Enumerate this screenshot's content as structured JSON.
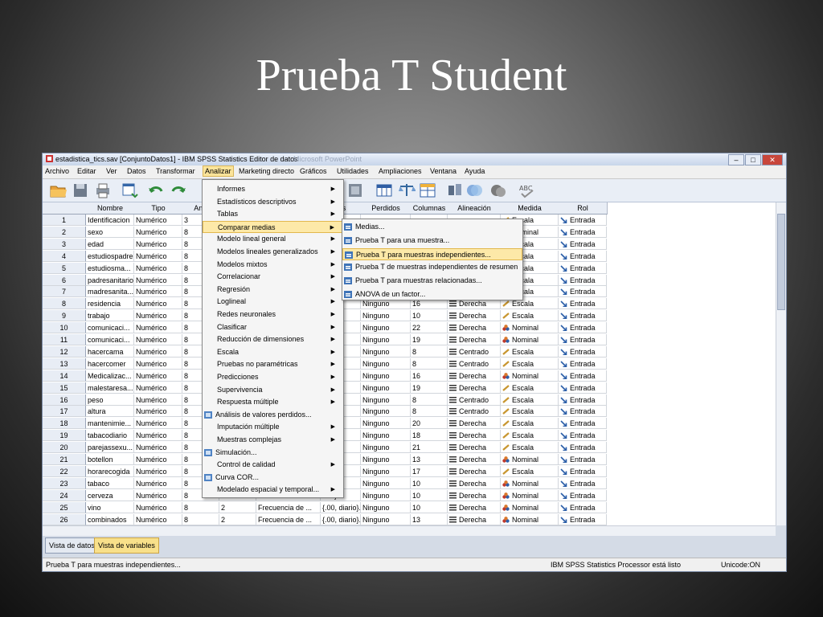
{
  "slide_title": "Prueba T Student",
  "window": {
    "title": "estadistica_tics.sav [ConjuntoDatos1] - IBM SPSS Statistics Editor de datos",
    "bg_title": "Microsoft PowerPoint",
    "buttons": [
      "–",
      "□",
      "✕"
    ]
  },
  "menubar": [
    "Archivo",
    "Editar",
    "Ver",
    "Datos",
    "Transformar",
    "Analizar",
    "Marketing directo",
    "Gráficos",
    "Utilidades",
    "Ampliaciones",
    "Ventana",
    "Ayuda"
  ],
  "menubar_active": "Analizar",
  "columns": [
    "Nombre",
    "Tipo",
    "Ancl",
    "res",
    "Perdidos",
    "Columnas",
    "Alineación",
    "Medida",
    "Rol"
  ],
  "rows": [
    {
      "n": "1",
      "nombre": "Identificacion",
      "tipo": "Numérico",
      "anc": "3",
      "dec": "",
      "etiq": "",
      "val": "",
      "perd": "",
      "col": "",
      "alin": "",
      "medida": "Escala",
      "rol": "Entrada"
    },
    {
      "n": "2",
      "nombre": "sexo",
      "tipo": "Numérico",
      "anc": "8",
      "dec": "",
      "etiq": "",
      "val": "",
      "perd": "",
      "col": "",
      "alin": "",
      "medida": "Nominal",
      "rol": "Entrada"
    },
    {
      "n": "3",
      "nombre": "edad",
      "tipo": "Numérico",
      "anc": "8",
      "dec": "",
      "etiq": "",
      "val": "",
      "perd": "",
      "col": "",
      "alin": "",
      "medida": "Escala",
      "rol": "Entrada"
    },
    {
      "n": "4",
      "nombre": "estudiospadre",
      "tipo": "Numérico",
      "anc": "8",
      "dec": "",
      "etiq": "",
      "val": "",
      "perd": "",
      "col": "",
      "alin": "",
      "medida": "Escala",
      "rol": "Entrada"
    },
    {
      "n": "5",
      "nombre": "estudiosma...",
      "tipo": "Numérico",
      "anc": "8",
      "dec": "",
      "etiq": "",
      "val": "",
      "perd": "",
      "col": "",
      "alin": "",
      "medida": "Escala",
      "rol": "Entrada"
    },
    {
      "n": "6",
      "nombre": "padresanitario",
      "tipo": "Numérico",
      "anc": "8",
      "dec": "",
      "etiq": "",
      "val": "",
      "perd": "",
      "col": "",
      "alin": "",
      "medida": "Escala",
      "rol": "Entrada"
    },
    {
      "n": "7",
      "nombre": "madresanita...",
      "tipo": "Numérico",
      "anc": "8",
      "dec": "",
      "etiq": "",
      "val": "",
      "perd": "",
      "col": "",
      "alin": "",
      "medida": "Escala",
      "rol": "Entrada"
    },
    {
      "n": "8",
      "nombre": "residencia",
      "tipo": "Numérico",
      "anc": "8",
      "dec": "",
      "etiq": "",
      "val": "iliar ...",
      "perd": "Ninguno",
      "col": "16",
      "alin": "Derecha",
      "medida": "Escala",
      "rol": "Entrada"
    },
    {
      "n": "9",
      "nombre": "trabajo",
      "tipo": "Numérico",
      "anc": "8",
      "dec": "",
      "etiq": "",
      "val": "",
      "perd": "Ninguno",
      "col": "10",
      "alin": "Derecha",
      "medida": "Escala",
      "rol": "Entrada"
    },
    {
      "n": "10",
      "nombre": "comunicaci...",
      "tipo": "Numérico",
      "anc": "8",
      "dec": "",
      "etiq": "",
      "val": "",
      "perd": "Ninguno",
      "col": "22",
      "alin": "Derecha",
      "medida": "Nominal",
      "rol": "Entrada"
    },
    {
      "n": "11",
      "nombre": "comunicaci...",
      "tipo": "Numérico",
      "anc": "8",
      "dec": "",
      "etiq": "",
      "val": "",
      "perd": "Ninguno",
      "col": "19",
      "alin": "Derecha",
      "medida": "Nominal",
      "rol": "Entrada"
    },
    {
      "n": "12",
      "nombre": "hacercama",
      "tipo": "Numérico",
      "anc": "8",
      "dec": "",
      "etiq": "",
      "val": "a)}...",
      "perd": "Ninguno",
      "col": "8",
      "alin": "Centrado",
      "medida": "Escala",
      "rol": "Entrada"
    },
    {
      "n": "13",
      "nombre": "hacercomer",
      "tipo": "Numérico",
      "anc": "8",
      "dec": "",
      "etiq": "",
      "val": "a)}...",
      "perd": "Ninguno",
      "col": "8",
      "alin": "Centrado",
      "medida": "Escala",
      "rol": "Entrada"
    },
    {
      "n": "14",
      "nombre": "Medicalizac...",
      "tipo": "Numérico",
      "anc": "8",
      "dec": "",
      "etiq": "",
      "val": "",
      "perd": "Ninguno",
      "col": "16",
      "alin": "Derecha",
      "medida": "Nominal",
      "rol": "Entrada"
    },
    {
      "n": "15",
      "nombre": "malestaresa...",
      "tipo": "Numérico",
      "anc": "8",
      "dec": "",
      "etiq": "",
      "val": "",
      "perd": "Ninguno",
      "col": "19",
      "alin": "Derecha",
      "medida": "Escala",
      "rol": "Entrada"
    },
    {
      "n": "16",
      "nombre": "peso",
      "tipo": "Numérico",
      "anc": "8",
      "dec": "",
      "etiq": "",
      "val": "",
      "perd": "Ninguno",
      "col": "8",
      "alin": "Centrado",
      "medida": "Escala",
      "rol": "Entrada"
    },
    {
      "n": "17",
      "nombre": "altura",
      "tipo": "Numérico",
      "anc": "8",
      "dec": "",
      "etiq": "",
      "val": "",
      "perd": "Ninguno",
      "col": "8",
      "alin": "Centrado",
      "medida": "Escala",
      "rol": "Entrada"
    },
    {
      "n": "18",
      "nombre": "mantenimie...",
      "tipo": "Numérico",
      "anc": "8",
      "dec": "",
      "etiq": "",
      "val": "",
      "perd": "Ninguno",
      "col": "20",
      "alin": "Derecha",
      "medida": "Escala",
      "rol": "Entrada"
    },
    {
      "n": "19",
      "nombre": "tabacodiario",
      "tipo": "Numérico",
      "anc": "8",
      "dec": "",
      "etiq": "",
      "val": "ma...",
      "perd": "Ninguno",
      "col": "18",
      "alin": "Derecha",
      "medida": "Escala",
      "rol": "Entrada"
    },
    {
      "n": "20",
      "nombre": "parejassexu...",
      "tipo": "Numérico",
      "anc": "8",
      "dec": "",
      "etiq": "",
      "val": "nas}...",
      "perd": "Ninguno",
      "col": "21",
      "alin": "Derecha",
      "medida": "Escala",
      "rol": "Entrada"
    },
    {
      "n": "21",
      "nombre": "botellon",
      "tipo": "Numérico",
      "anc": "8",
      "dec": "",
      "etiq": "",
      "val": "ario}...",
      "perd": "Ninguno",
      "col": "13",
      "alin": "Derecha",
      "medida": "Nominal",
      "rol": "Entrada"
    },
    {
      "n": "22",
      "nombre": "horarecogida",
      "tipo": "Numérico",
      "anc": "8",
      "dec": "",
      "etiq": "",
      "val": "ues...",
      "perd": "Ninguno",
      "col": "17",
      "alin": "Derecha",
      "medida": "Escala",
      "rol": "Entrada"
    },
    {
      "n": "23",
      "nombre": "tabaco",
      "tipo": "Numérico",
      "anc": "8",
      "dec": "",
      "etiq": "",
      "val": "ario}...",
      "perd": "Ninguno",
      "col": "10",
      "alin": "Derecha",
      "medida": "Nominal",
      "rol": "Entrada"
    },
    {
      "n": "24",
      "nombre": "cerveza",
      "tipo": "Numérico",
      "anc": "8",
      "dec": "",
      "etiq": "",
      "val": "ario}...",
      "perd": "Ninguno",
      "col": "10",
      "alin": "Derecha",
      "medida": "Nominal",
      "rol": "Entrada"
    },
    {
      "n": "25",
      "nombre": "vino",
      "tipo": "Numérico",
      "anc": "8",
      "dec": "2",
      "etiq": "Frecuencia de ...",
      "val": "{.00, diario}...",
      "perd": "Ninguno",
      "col": "10",
      "alin": "Derecha",
      "medida": "Nominal",
      "rol": "Entrada"
    },
    {
      "n": "26",
      "nombre": "combinados",
      "tipo": "Numérico",
      "anc": "8",
      "dec": "2",
      "etiq": "Frecuencia de ...",
      "val": "{.00, diario}...",
      "perd": "Ninguno",
      "col": "13",
      "alin": "Derecha",
      "medida": "Nominal",
      "rol": "Entrada"
    }
  ],
  "analizar_menu": [
    {
      "label": "Informes",
      "arrow": true
    },
    {
      "label": "Estadísticos descriptivos",
      "arrow": true
    },
    {
      "label": "Tablas",
      "arrow": true
    },
    {
      "label": "Comparar medias",
      "arrow": true,
      "hl": true
    },
    {
      "label": "Modelo lineal general",
      "arrow": true
    },
    {
      "label": "Modelos lineales generalizados",
      "arrow": true
    },
    {
      "label": "Modelos mixtos",
      "arrow": true
    },
    {
      "label": "Correlacionar",
      "arrow": true
    },
    {
      "label": "Regresión",
      "arrow": true
    },
    {
      "label": "Loglineal",
      "arrow": true
    },
    {
      "label": "Redes neuronales",
      "arrow": true
    },
    {
      "label": "Clasificar",
      "arrow": true
    },
    {
      "label": "Reducción de dimensiones",
      "arrow": true
    },
    {
      "label": "Escala",
      "arrow": true
    },
    {
      "label": "Pruebas no paramétricas",
      "arrow": true
    },
    {
      "label": "Predicciones",
      "arrow": true
    },
    {
      "label": "Supervivencia",
      "arrow": true
    },
    {
      "label": "Respuesta múltiple",
      "arrow": true
    },
    {
      "label": "Análisis de valores perdidos...",
      "arrow": false,
      "icon": true
    },
    {
      "label": "Imputación múltiple",
      "arrow": true
    },
    {
      "label": "Muestras complejas",
      "arrow": true
    },
    {
      "label": "Simulación...",
      "arrow": false,
      "icon": true
    },
    {
      "label": "Control de calidad",
      "arrow": true
    },
    {
      "label": "Curva COR...",
      "arrow": false,
      "icon": true
    },
    {
      "label": "Modelado espacial y temporal...",
      "arrow": true
    }
  ],
  "comparar_submenu": [
    {
      "label": "Medias..."
    },
    {
      "label": "Prueba T para una muestra..."
    },
    {
      "label": "Prueba T para muestras independientes...",
      "hl": true
    },
    {
      "label": "Prueba T de muestras independientes de resumen"
    },
    {
      "label": "Prueba T para muestras relacionadas..."
    },
    {
      "label": "ANOVA de un factor..."
    }
  ],
  "tabs": [
    "Vista de datos",
    "Vista de variables"
  ],
  "status": {
    "left": "Prueba T para muestras independientes...",
    "processor": "IBM SPSS Statistics Processor está listo",
    "unicode": "Unicode:ON"
  }
}
